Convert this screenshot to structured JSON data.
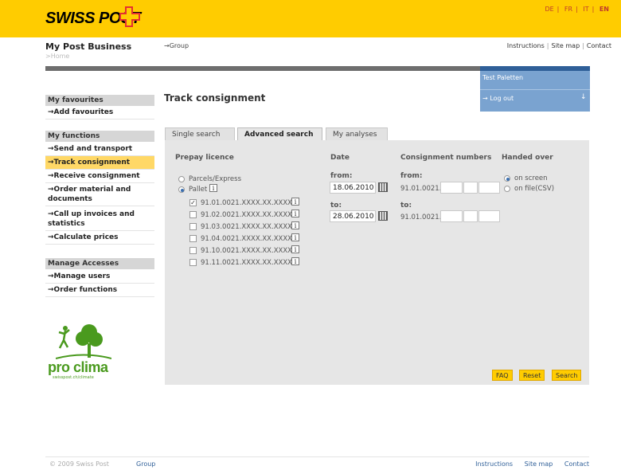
{
  "header": {
    "logo_text": "SWISS POST",
    "languages": [
      "DE",
      "FR",
      "IT",
      "EN"
    ],
    "active_language": "EN",
    "brand_color": "#FFCC00"
  },
  "nav": {
    "site_title": "My Post Business",
    "breadcrumb": ">Home",
    "group_link": "→Group",
    "top_links": [
      "Instructions",
      "Site map",
      "Contact"
    ]
  },
  "user": {
    "name": "Test Paletten",
    "logout": "→ Log out",
    "logout_icon": "↓"
  },
  "sidebar": {
    "favourites_title": "My favourites",
    "favourites_items": [
      "→Add favourites"
    ],
    "functions_title": "My functions",
    "functions_items": [
      "→Send and transport",
      "→Track consignment",
      "→Receive consignment",
      "→Order material and documents",
      "→Call up invoices and statistics",
      "→Calculate prices"
    ],
    "active_function": "→Track consignment",
    "access_title": "Manage Accesses",
    "access_items": [
      "→Manage users",
      "→Order functions"
    ],
    "climate_logo": "pro clima",
    "climate_sub": "swisspost.ch/climate"
  },
  "main": {
    "page_title": "Track consignment",
    "tabs": [
      "Single search",
      "Advanced search",
      "My analyses"
    ],
    "active_tab": "Advanced search",
    "prepay": {
      "title": "Prepay licence",
      "options": [
        "Parcels/Express",
        "Pallet"
      ],
      "selected": "Pallet",
      "licences": [
        {
          "label": "91.01.0021.XXXX.XX.XXXX",
          "checked": true
        },
        {
          "label": "91.02.0021.XXXX.XX.XXXX",
          "checked": false
        },
        {
          "label": "91.03.0021.XXXX.XX.XXXX",
          "checked": false
        },
        {
          "label": "91.04.0021.XXXX.XX.XXXX",
          "checked": false
        },
        {
          "label": "91.10.0021.XXXX.XX.XXXX",
          "checked": false
        },
        {
          "label": "91.11.0021.XXXX.XX.XXXX",
          "checked": false
        }
      ],
      "info_icon": "i",
      "check_mark": "✓"
    },
    "date": {
      "title": "Date",
      "from_label": "from:",
      "from_value": "18.06.2010",
      "to_label": "to:",
      "to_value": "28.06.2010"
    },
    "consignment": {
      "title": "Consignment numbers",
      "from_label": "from:",
      "to_label": "to:",
      "prefix": "91.01.0021."
    },
    "handed_over": {
      "title": "Handed over",
      "options": [
        "on screen",
        "on file(CSV)"
      ],
      "selected": "on screen"
    },
    "buttons": {
      "faq": "FAQ",
      "reset": "Reset",
      "search": "Search"
    }
  },
  "footer": {
    "copyright": "© 2009 Swiss Post",
    "group": "Group",
    "links": [
      "Instructions",
      "Site map",
      "Contact"
    ]
  }
}
